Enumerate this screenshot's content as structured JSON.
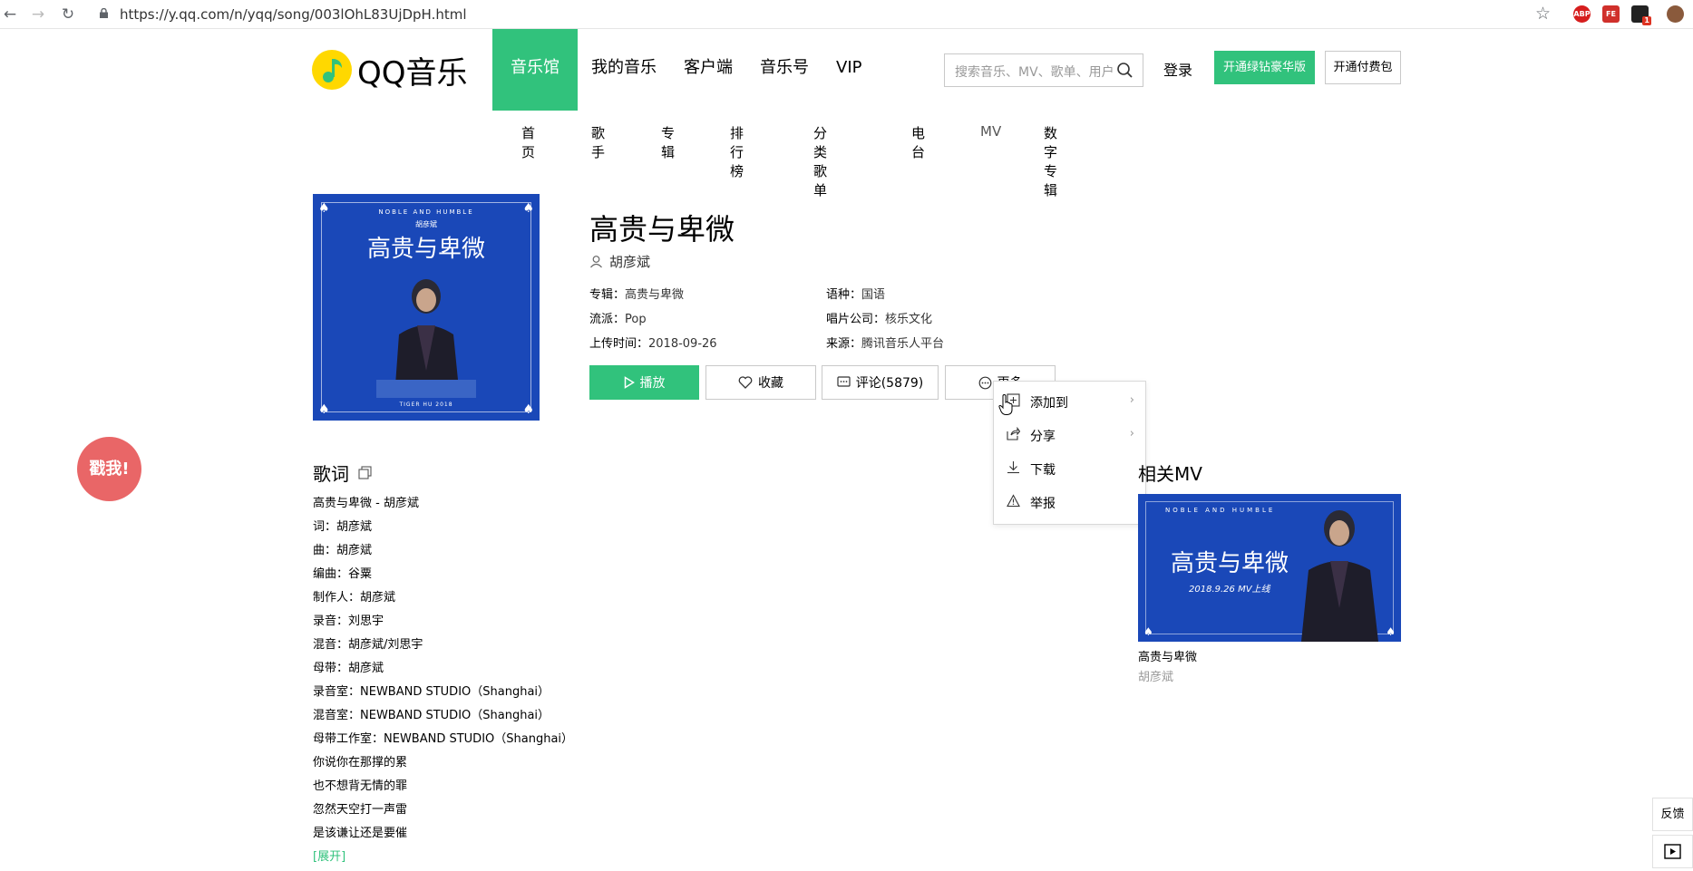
{
  "browser": {
    "url": "https://y.qq.com/n/yqq/song/003lOhL83UjDpH.html",
    "extensions": [
      "ABP",
      "FE",
      "1"
    ]
  },
  "header": {
    "logo_text": "QQ音乐",
    "nav": [
      "音乐馆",
      "我的音乐",
      "客户端",
      "音乐号",
      "VIP"
    ],
    "active_nav": "音乐馆",
    "search_placeholder": "搜索音乐、MV、歌单、用户",
    "login": "登录",
    "vip_button": "开通绿钻豪华版",
    "pay_button": "开通付费包"
  },
  "subnav": [
    "首页",
    "歌手",
    "专辑",
    "排行榜",
    "分类歌单",
    "电台",
    "MV",
    "数字专辑"
  ],
  "cover": {
    "top_text": "NOBLE AND HUMBLE",
    "artist_small": "胡彦斌",
    "title_art": "高贵与卑微",
    "bottom_text": "TIGER HU 2018"
  },
  "song": {
    "title": "高贵与卑微",
    "singer": "胡彦斌",
    "album_label": "专辑：",
    "album": "高贵与卑微",
    "language_label": "语种：",
    "language": "国语",
    "genre_label": "流派：",
    "genre": "Pop",
    "company_label": "唱片公司：",
    "company": "核乐文化",
    "upload_label": "上传时间：",
    "upload_time": "2018-09-26",
    "source_label": "来源：",
    "source": "腾讯音乐人平台"
  },
  "actions": {
    "play": "播放",
    "favorite": "收藏",
    "comment": "评论(5879)",
    "more": "更多"
  },
  "more_menu": [
    "添加到",
    "分享",
    "下载",
    "举报"
  ],
  "poke": "戳我!",
  "lyrics": {
    "heading": "歌词",
    "lines": [
      "高贵与卑微 - 胡彦斌",
      "词：胡彦斌",
      "曲：胡彦斌",
      "编曲：谷粟",
      "制作人：胡彦斌",
      "录音：刘思宇",
      "混音：胡彦斌/刘思宇",
      "母带：胡彦斌",
      "录音室：NEWBAND STUDIO（Shanghai）",
      "混音室：NEWBAND STUDIO（Shanghai）",
      "母带工作室：NEWBAND STUDIO（Shanghai）",
      "你说你在那撑的累",
      "也不想背无情的罪",
      "忽然天空打一声雷",
      "是该谦让还是要催"
    ],
    "expand": "[展开]"
  },
  "related_mv": {
    "heading": "相关MV",
    "thumb_title": "高贵与卑微",
    "thumb_en": "NOBLE AND HUMBLE",
    "thumb_date": "2018.9.26 MV上线",
    "name": "高贵与卑微",
    "singer": "胡彦斌"
  },
  "side_tools": {
    "feedback": "反馈"
  },
  "colors": {
    "brand_green": "#31c27c",
    "cover_blue": "#1a48b8",
    "poke_red": "#e96667"
  }
}
